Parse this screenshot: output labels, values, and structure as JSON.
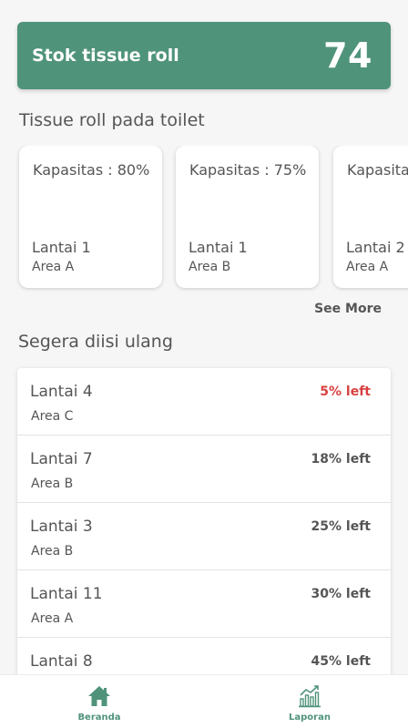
{
  "stock": {
    "label": "Stok tissue roll",
    "value": "74"
  },
  "rolls_section": {
    "title": "Tissue roll pada toilet",
    "see_more": "See More"
  },
  "rolls": [
    {
      "capacity": "Kapasitas : 80%",
      "floor": "Lantai 1",
      "area": "Area A"
    },
    {
      "capacity": "Kapasitas  : 75%",
      "floor": "Lantai 1",
      "area": "Area B"
    },
    {
      "capacity": "Kapasitas",
      "floor": "Lantai 2",
      "area": "Area A"
    }
  ],
  "refill_section": {
    "title": "Segera diisi ulang"
  },
  "refill": [
    {
      "floor": "Lantai 4",
      "area": "Area C",
      "left": "5% left",
      "status": "critical"
    },
    {
      "floor": "Lantai 7",
      "area": "Area B",
      "left": "18% left",
      "status": "normal"
    },
    {
      "floor": "Lantai 3",
      "area": "Area B",
      "left": "25% left",
      "status": "normal"
    },
    {
      "floor": "Lantai 11",
      "area": "Area A",
      "left": "30% left",
      "status": "normal"
    },
    {
      "floor": "Lantai 8",
      "area": "",
      "left": "45% left",
      "status": "normal"
    }
  ],
  "nav": {
    "home": {
      "label": "Beranda",
      "icon": "home-icon"
    },
    "report": {
      "label": "Laporan",
      "icon": "bar-chart-icon"
    }
  },
  "colors": {
    "accent": "#4f937a",
    "critical": "#d94040"
  }
}
